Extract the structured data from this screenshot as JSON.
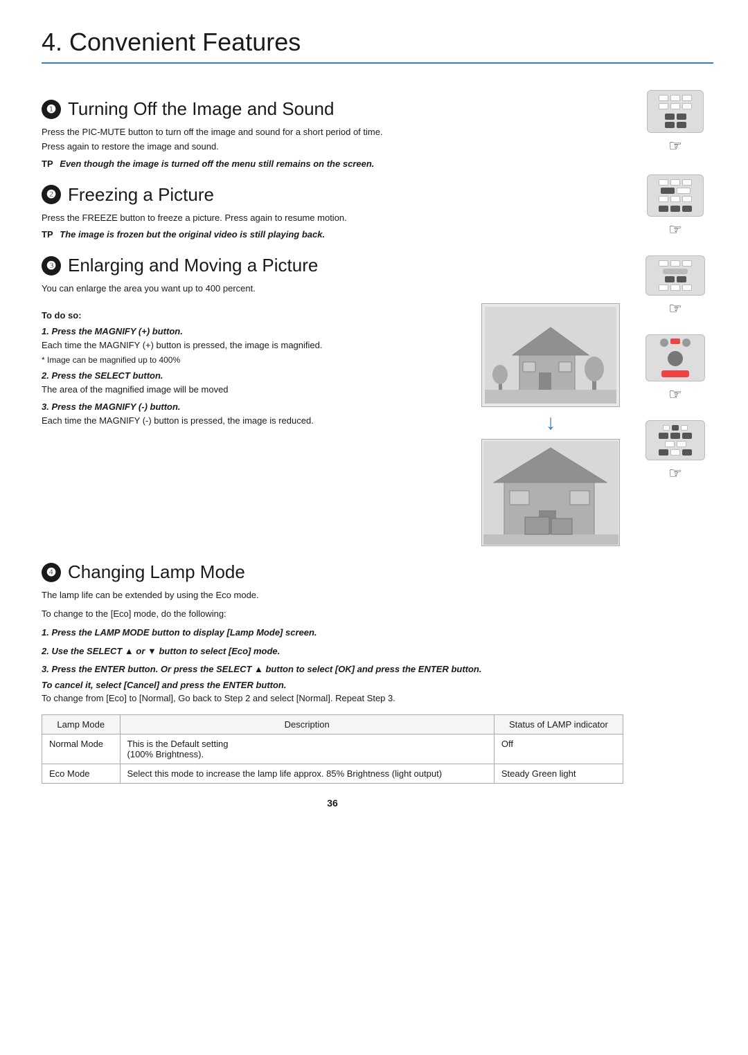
{
  "page": {
    "title": "4. Convenient Features",
    "number": "36"
  },
  "sections": [
    {
      "id": "s1",
      "number": "1",
      "title": "Turning Off the Image and Sound",
      "body": "Press the PIC-MUTE button to turn off the image and sound for a short period of time.\nPress again to restore the image and sound.",
      "tp_note": "Even though the image is turned off the menu still remains on the screen."
    },
    {
      "id": "s2",
      "number": "2",
      "title": "Freezing a Picture",
      "body": "Press the FREEZE button to freeze a picture. Press again to resume motion.",
      "tp_note": "The image is frozen but the original video is still playing back."
    },
    {
      "id": "s3",
      "number": "3",
      "title": "Enlarging and Moving a Picture",
      "body": "You can enlarge the area you want up to 400 percent.",
      "to_do_so": "To do so:",
      "steps": [
        {
          "label": "1.  Press the MAGNIFY (+) button.",
          "body": "Each time the MAGNIFY (+) button is pressed, the image is magnified.",
          "note": "* Image can be magnified up to 400%"
        },
        {
          "label": "2.  Press the SELECT        button.",
          "body": "The area of the magnified image will be moved"
        },
        {
          "label": "3.  Press the MAGNIFY (-) button.",
          "body": "Each time the MAGNIFY (-) button is pressed, the image is reduced."
        }
      ]
    },
    {
      "id": "s4",
      "number": "4",
      "title": "Changing Lamp Mode",
      "body1": "The lamp life can be extended by using the Eco mode.",
      "body2": "To change to the [Eco] mode, do the following:",
      "steps": [
        "1.  Press the LAMP MODE button to display [Lamp Mode] screen.",
        "2.  Use the SELECT   or    button to select [Eco] mode.",
        "3.  Press the ENTER button. Or press the SELECT    button to select [OK] and press the ENTER button.",
        "To cancel it, select [Cancel] and press the ENTER button.",
        "To change from [Eco] to [Normal], Go back to Step 2 and select [Normal]. Repeat Step 3."
      ]
    }
  ],
  "table": {
    "headers": [
      "Lamp Mode",
      "Description",
      "Status of LAMP indicator"
    ],
    "rows": [
      {
        "mode": "Normal Mode",
        "description": "This is the Default setting\n(100% Brightness).",
        "status": "Off"
      },
      {
        "mode": "Eco Mode",
        "description": "Select this mode to increase the lamp life approx. 85% Brightness (light output)",
        "status": "Steady Green light"
      }
    ]
  }
}
